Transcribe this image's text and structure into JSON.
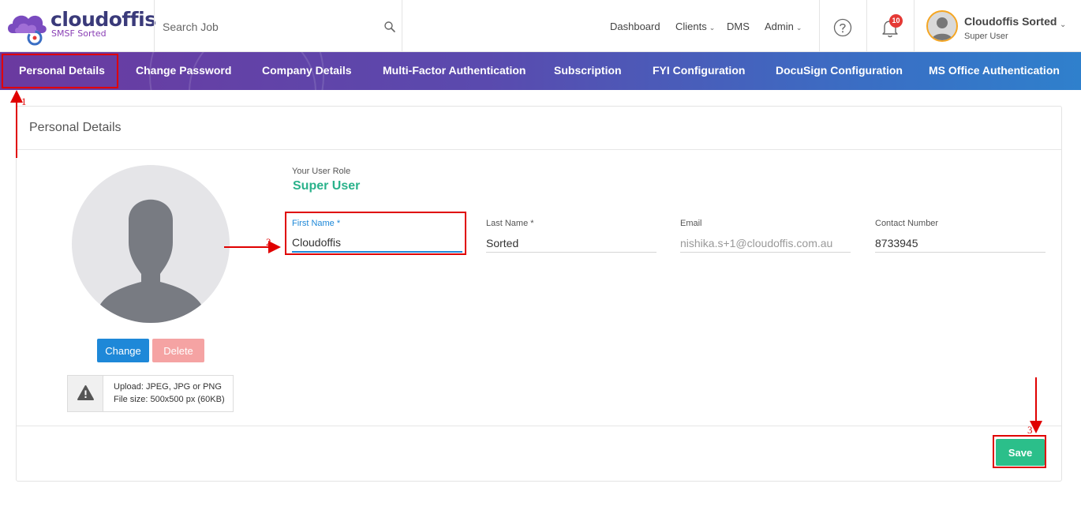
{
  "brand": {
    "name": "cloudoffis",
    "tagline": "SMSF Sorted"
  },
  "search": {
    "placeholder": "Search Job"
  },
  "topnav": {
    "dashboard": "Dashboard",
    "clients": "Clients",
    "dms": "DMS",
    "admin": "Admin"
  },
  "notifications": {
    "count": "10"
  },
  "user": {
    "name": "Cloudoffis Sorted",
    "role": "Super User"
  },
  "tabs": [
    {
      "label": "Personal Details",
      "active": true
    },
    {
      "label": "Change Password"
    },
    {
      "label": "Company Details"
    },
    {
      "label": "Multi-Factor Authentication"
    },
    {
      "label": "Subscription"
    },
    {
      "label": "FYI Configuration"
    },
    {
      "label": "DocuSign Configuration"
    },
    {
      "label": "MS Office Authentication"
    }
  ],
  "card": {
    "title": "Personal Details",
    "change_label": "Change",
    "delete_label": "Delete",
    "upload_line1": "Upload: JPEG, JPG or PNG",
    "upload_line2": "File size: 500x500 px (60KB)",
    "role_label": "Your User Role",
    "role_value": "Super User",
    "fields": {
      "first_name": {
        "label": "First Name *",
        "value": "Cloudoffis"
      },
      "last_name": {
        "label": "Last Name *",
        "value": "Sorted"
      },
      "email": {
        "label": "Email",
        "value": "nishika.s+1@cloudoffis.com.au"
      },
      "contact": {
        "label": "Contact Number",
        "value": "8733945"
      }
    },
    "save_label": "Save"
  },
  "annotations": {
    "step1": "1",
    "step2": "2",
    "step3": "3"
  },
  "colors": {
    "accent_green": "#2ab28b",
    "primary_blue": "#1e88d8",
    "annotation_red": "#e00000"
  }
}
